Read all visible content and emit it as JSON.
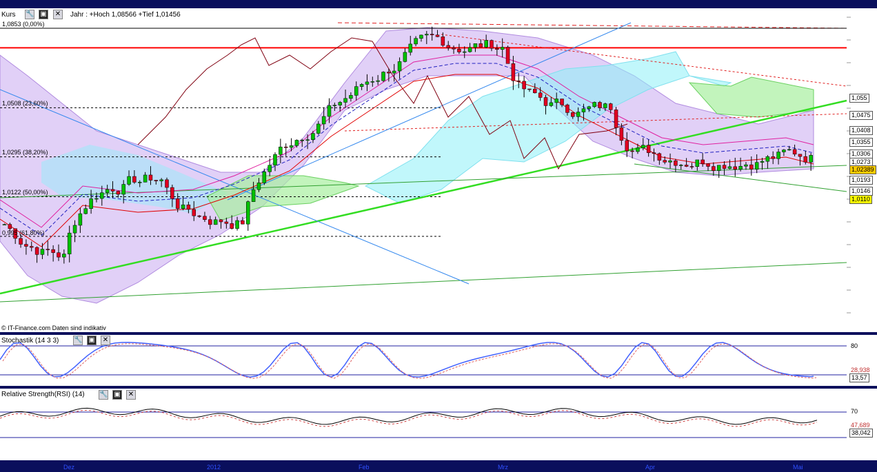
{
  "main_panel": {
    "title": "Kurs",
    "info": "Jahr : +Hoch 1,08566 +Tief 1,01456",
    "credit": "© IT-Finance.com  Daten sind indikativ",
    "fib_levels": [
      {
        "label": "1,0853 (0,00%)",
        "value": 1.0853
      },
      {
        "label": "1,0508 (23,60%)",
        "value": 1.0508
      },
      {
        "label": "1,0295 (38,20%)",
        "value": 1.0295
      },
      {
        "label": "1,0122 (50,00%)",
        "value": 1.0122
      },
      {
        "label": "0,995 (61,80%)",
        "value": 0.995
      }
    ],
    "price_boxes": [
      {
        "label": "1,055",
        "bg": "#ffffff",
        "fg": "#000000"
      },
      {
        "label": "1,0475",
        "bg": "#ffffff",
        "fg": "#000000"
      },
      {
        "label": "1,0408",
        "bg": "#ffffff",
        "fg": "#000000"
      },
      {
        "label": "1,0355",
        "bg": "#ffffff",
        "fg": "#000000"
      },
      {
        "label": "1,0306",
        "bg": "#ffffff",
        "fg": "#000000"
      },
      {
        "label": "1,0273",
        "bg": "#ffffff",
        "fg": "#000000"
      },
      {
        "label": "1,02389",
        "bg": "#ffcc00",
        "fg": "#000000"
      },
      {
        "label": "1,0193",
        "bg": "#ffffff",
        "fg": "#000000"
      },
      {
        "label": "1,0146",
        "bg": "#ffffff",
        "fg": "#000000"
      },
      {
        "label": "1,0110",
        "bg": "#ffff00",
        "fg": "#000000"
      }
    ]
  },
  "stoch_panel": {
    "title": "Stochastik (14 3 3)",
    "levels": [
      "80",
      "20"
    ],
    "value_boxes": [
      "28,938",
      "13,57"
    ]
  },
  "rsi_panel": {
    "title": "Relative Strength(RSI) (14)",
    "levels": [
      "70",
      "30"
    ],
    "value_boxes": [
      "47,689",
      "38,042"
    ]
  },
  "x_axis_labels": [
    "Dez",
    "2012",
    "Feb",
    "Mrz",
    "Apr",
    "Mai"
  ],
  "chart_data": {
    "type": "candlestick",
    "last_price": 1.02389,
    "year_high": 1.08566,
    "year_low": 1.01456,
    "stochastic": {
      "k": 13.57,
      "d": 28.938
    },
    "rsi": 38.042
  },
  "colors": {
    "up": "#00c000",
    "down": "#e00020",
    "cloud": "#c9a9f0",
    "kumo_cyan": "#8ef0f8",
    "resistance": "#ff0000",
    "trend": "#33dd22"
  }
}
